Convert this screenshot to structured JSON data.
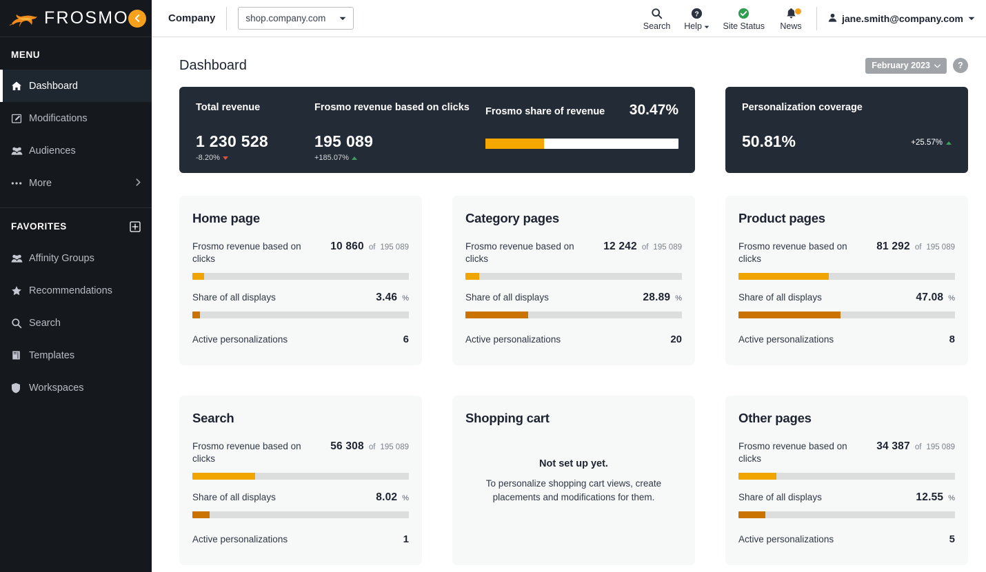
{
  "brand": {
    "name": "FROSMO",
    "accent": "#f5a11d",
    "collapse_icon": "chevron-left-icon"
  },
  "sidebar": {
    "menu_heading": "MENU",
    "menu_items": [
      {
        "label": "Dashboard",
        "icon": "home-icon",
        "active": true
      },
      {
        "label": "Modifications",
        "icon": "edit-square-icon",
        "active": false
      },
      {
        "label": "Audiences",
        "icon": "users-icon",
        "active": false
      },
      {
        "label": "More",
        "icon": "ellipsis-icon",
        "active": false,
        "chevron": "chevron-right-icon"
      }
    ],
    "favorites_heading": "FAVORITES",
    "favorites_add_icon": "plus-square-icon",
    "favorites_items": [
      {
        "label": "Affinity Groups",
        "icon": "users-icon"
      },
      {
        "label": "Recommendations",
        "icon": "star-icon"
      },
      {
        "label": "Search",
        "icon": "search-icon"
      },
      {
        "label": "Templates",
        "icon": "book-icon"
      },
      {
        "label": "Workspaces",
        "icon": "shield-icon"
      }
    ]
  },
  "topbar": {
    "company_label": "Company",
    "site_value": "shop.company.com",
    "actions": [
      {
        "label": "Search",
        "icon": "search-icon"
      },
      {
        "label": "Help",
        "icon": "question-circle-icon",
        "caret": true
      },
      {
        "label": "Site Status",
        "icon": "check-circle-icon"
      },
      {
        "label": "News",
        "icon": "bell-icon",
        "badge": true
      }
    ],
    "user_email": "jane.smith@company.com",
    "user_icon": "user-icon"
  },
  "page": {
    "title": "Dashboard",
    "date_range": "February 2023",
    "date_caret_icon": "chevron-down-icon",
    "help_label": "?"
  },
  "kpi": {
    "total_revenue": {
      "label": "Total revenue",
      "value": "1 230 528",
      "delta": "-8.20%",
      "direction": "down"
    },
    "frosmo_revenue": {
      "label": "Frosmo revenue based on clicks",
      "value": "195 089",
      "delta": "+185.07%",
      "direction": "up"
    },
    "share": {
      "label": "Frosmo share of revenue",
      "value": "30.47%",
      "percent": 30.47
    },
    "coverage": {
      "label": "Personalization coverage",
      "value": "50.81%",
      "delta": "+25.57%",
      "direction": "up"
    }
  },
  "labels": {
    "revenue_metric": "Frosmo revenue based on clicks",
    "share_metric": "Share of all displays",
    "active_metric": "Active personalizations",
    "of": "of",
    "percent_sign": "%"
  },
  "chart_data": {
    "type": "bar",
    "title": "Per-page-type personalization performance",
    "total_frosmo_revenue": 195089,
    "cards": [
      {
        "title": "Home page",
        "revenue": "10 860",
        "revenue_value": 10860,
        "revenue_total": "195 089",
        "revenue_pct": 5.57,
        "share": "3.46",
        "share_value": 3.46,
        "active": "6",
        "empty": false
      },
      {
        "title": "Category pages",
        "revenue": "12 242",
        "revenue_value": 12242,
        "revenue_total": "195 089",
        "revenue_pct": 6.27,
        "share": "28.89",
        "share_value": 28.89,
        "active": "20",
        "empty": false
      },
      {
        "title": "Product pages",
        "revenue": "81 292",
        "revenue_value": 81292,
        "revenue_total": "195 089",
        "revenue_pct": 41.67,
        "share": "47.08",
        "share_value": 47.08,
        "active": "8",
        "empty": false
      },
      {
        "title": "Search",
        "revenue": "56 308",
        "revenue_value": 56308,
        "revenue_total": "195 089",
        "revenue_pct": 28.86,
        "share": "8.02",
        "share_value": 8.02,
        "active": "1",
        "empty": false
      },
      {
        "title": "Shopping cart",
        "empty": true,
        "empty_title": "Not set up yet.",
        "empty_desc": "To personalize shopping cart views, create placements and modifications for them."
      },
      {
        "title": "Other pages",
        "revenue": "34 387",
        "revenue_value": 34387,
        "revenue_total": "195 089",
        "revenue_pct": 17.63,
        "share": "12.55",
        "share_value": 12.55,
        "active": "5",
        "empty": false
      }
    ],
    "colors": {
      "revenue_bar": "#f0a500",
      "share_bar": "#ca7300",
      "track": "#dcdddd"
    }
  }
}
